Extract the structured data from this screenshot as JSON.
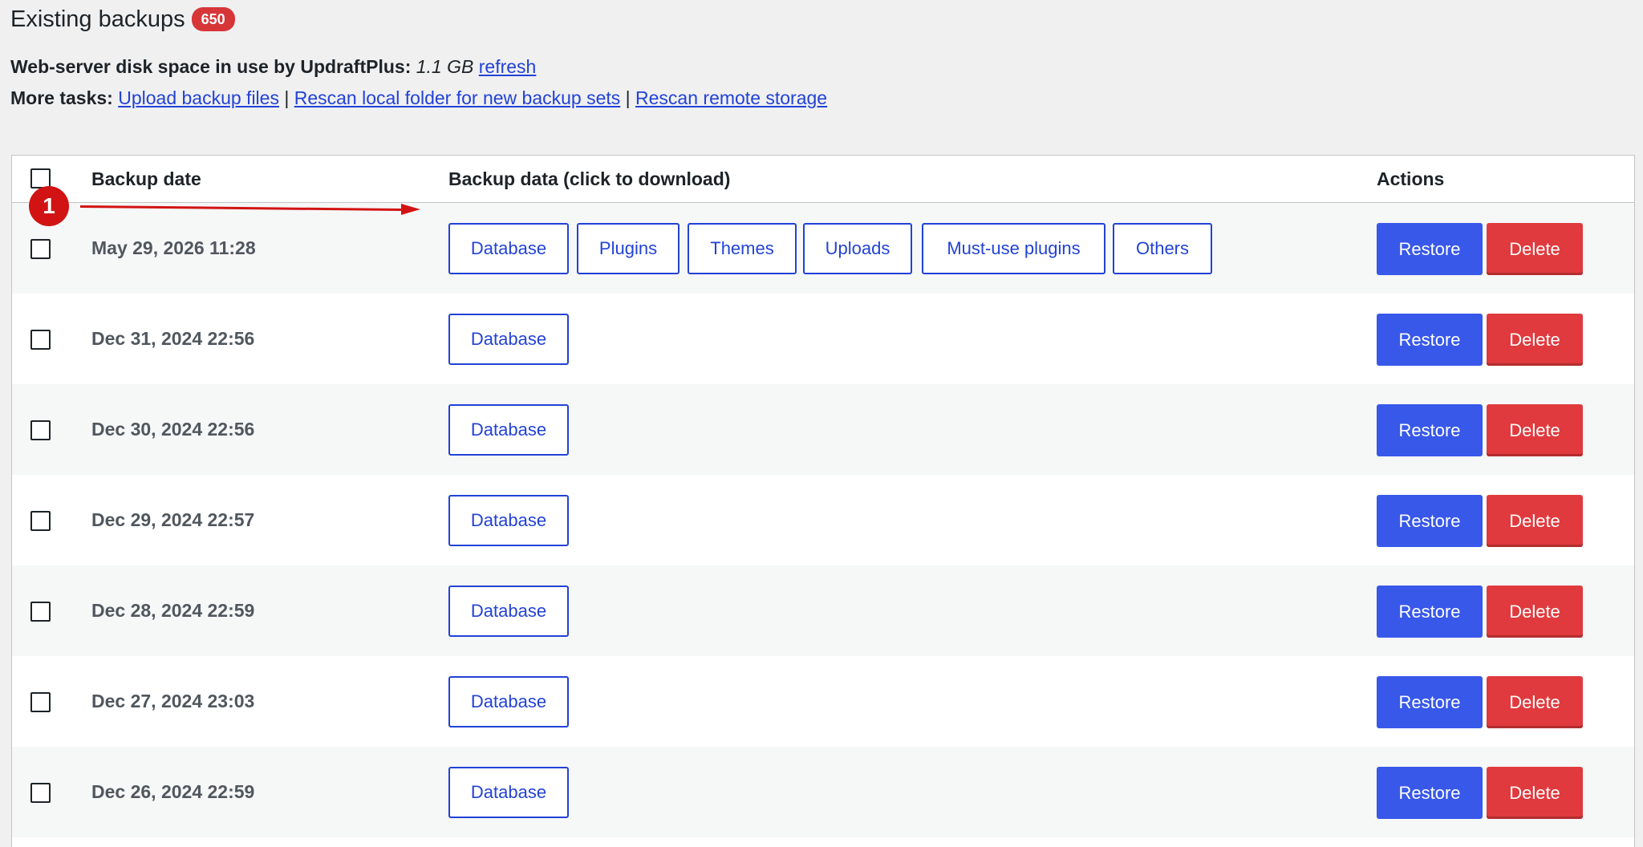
{
  "header": {
    "title": "Existing backups",
    "count": "650"
  },
  "disk_info": {
    "label": "Web-server disk space in use by UpdraftPlus:",
    "size": "1.1 GB",
    "refresh_link": "refresh"
  },
  "more_tasks": {
    "label": "More tasks:",
    "upload_link": "Upload backup files",
    "separator": "|",
    "rescan_local_link": "Rescan local folder for new backup sets",
    "rescan_remote_link": "Rescan remote storage"
  },
  "table": {
    "columns": {
      "date": "Backup date",
      "data": "Backup data (click to download)",
      "actions": "Actions"
    },
    "rows": [
      {
        "date": "May 29, 2026 11:28",
        "files": [
          "Database",
          "Plugins",
          "Themes",
          "Uploads",
          "Must-use plugins",
          "Others"
        ],
        "restore": "Restore",
        "delete": "Delete"
      },
      {
        "date": "Dec 31, 2024 22:56",
        "files": [
          "Database"
        ],
        "restore": "Restore",
        "delete": "Delete"
      },
      {
        "date": "Dec 30, 2024 22:56",
        "files": [
          "Database"
        ],
        "restore": "Restore",
        "delete": "Delete"
      },
      {
        "date": "Dec 29, 2024 22:57",
        "files": [
          "Database"
        ],
        "restore": "Restore",
        "delete": "Delete"
      },
      {
        "date": "Dec 28, 2024 22:59",
        "files": [
          "Database"
        ],
        "restore": "Restore",
        "delete": "Delete"
      },
      {
        "date": "Dec 27, 2024 23:03",
        "files": [
          "Database"
        ],
        "restore": "Restore",
        "delete": "Delete"
      },
      {
        "date": "Dec 26, 2024 22:59",
        "files": [
          "Database"
        ],
        "restore": "Restore",
        "delete": "Delete"
      }
    ]
  },
  "annotation": {
    "marker": "1",
    "color": "#d21313"
  },
  "colors": {
    "link": "#2242d6",
    "restore": "#3858e9",
    "delete": "#e03a3e",
    "badge": "#d63638"
  }
}
